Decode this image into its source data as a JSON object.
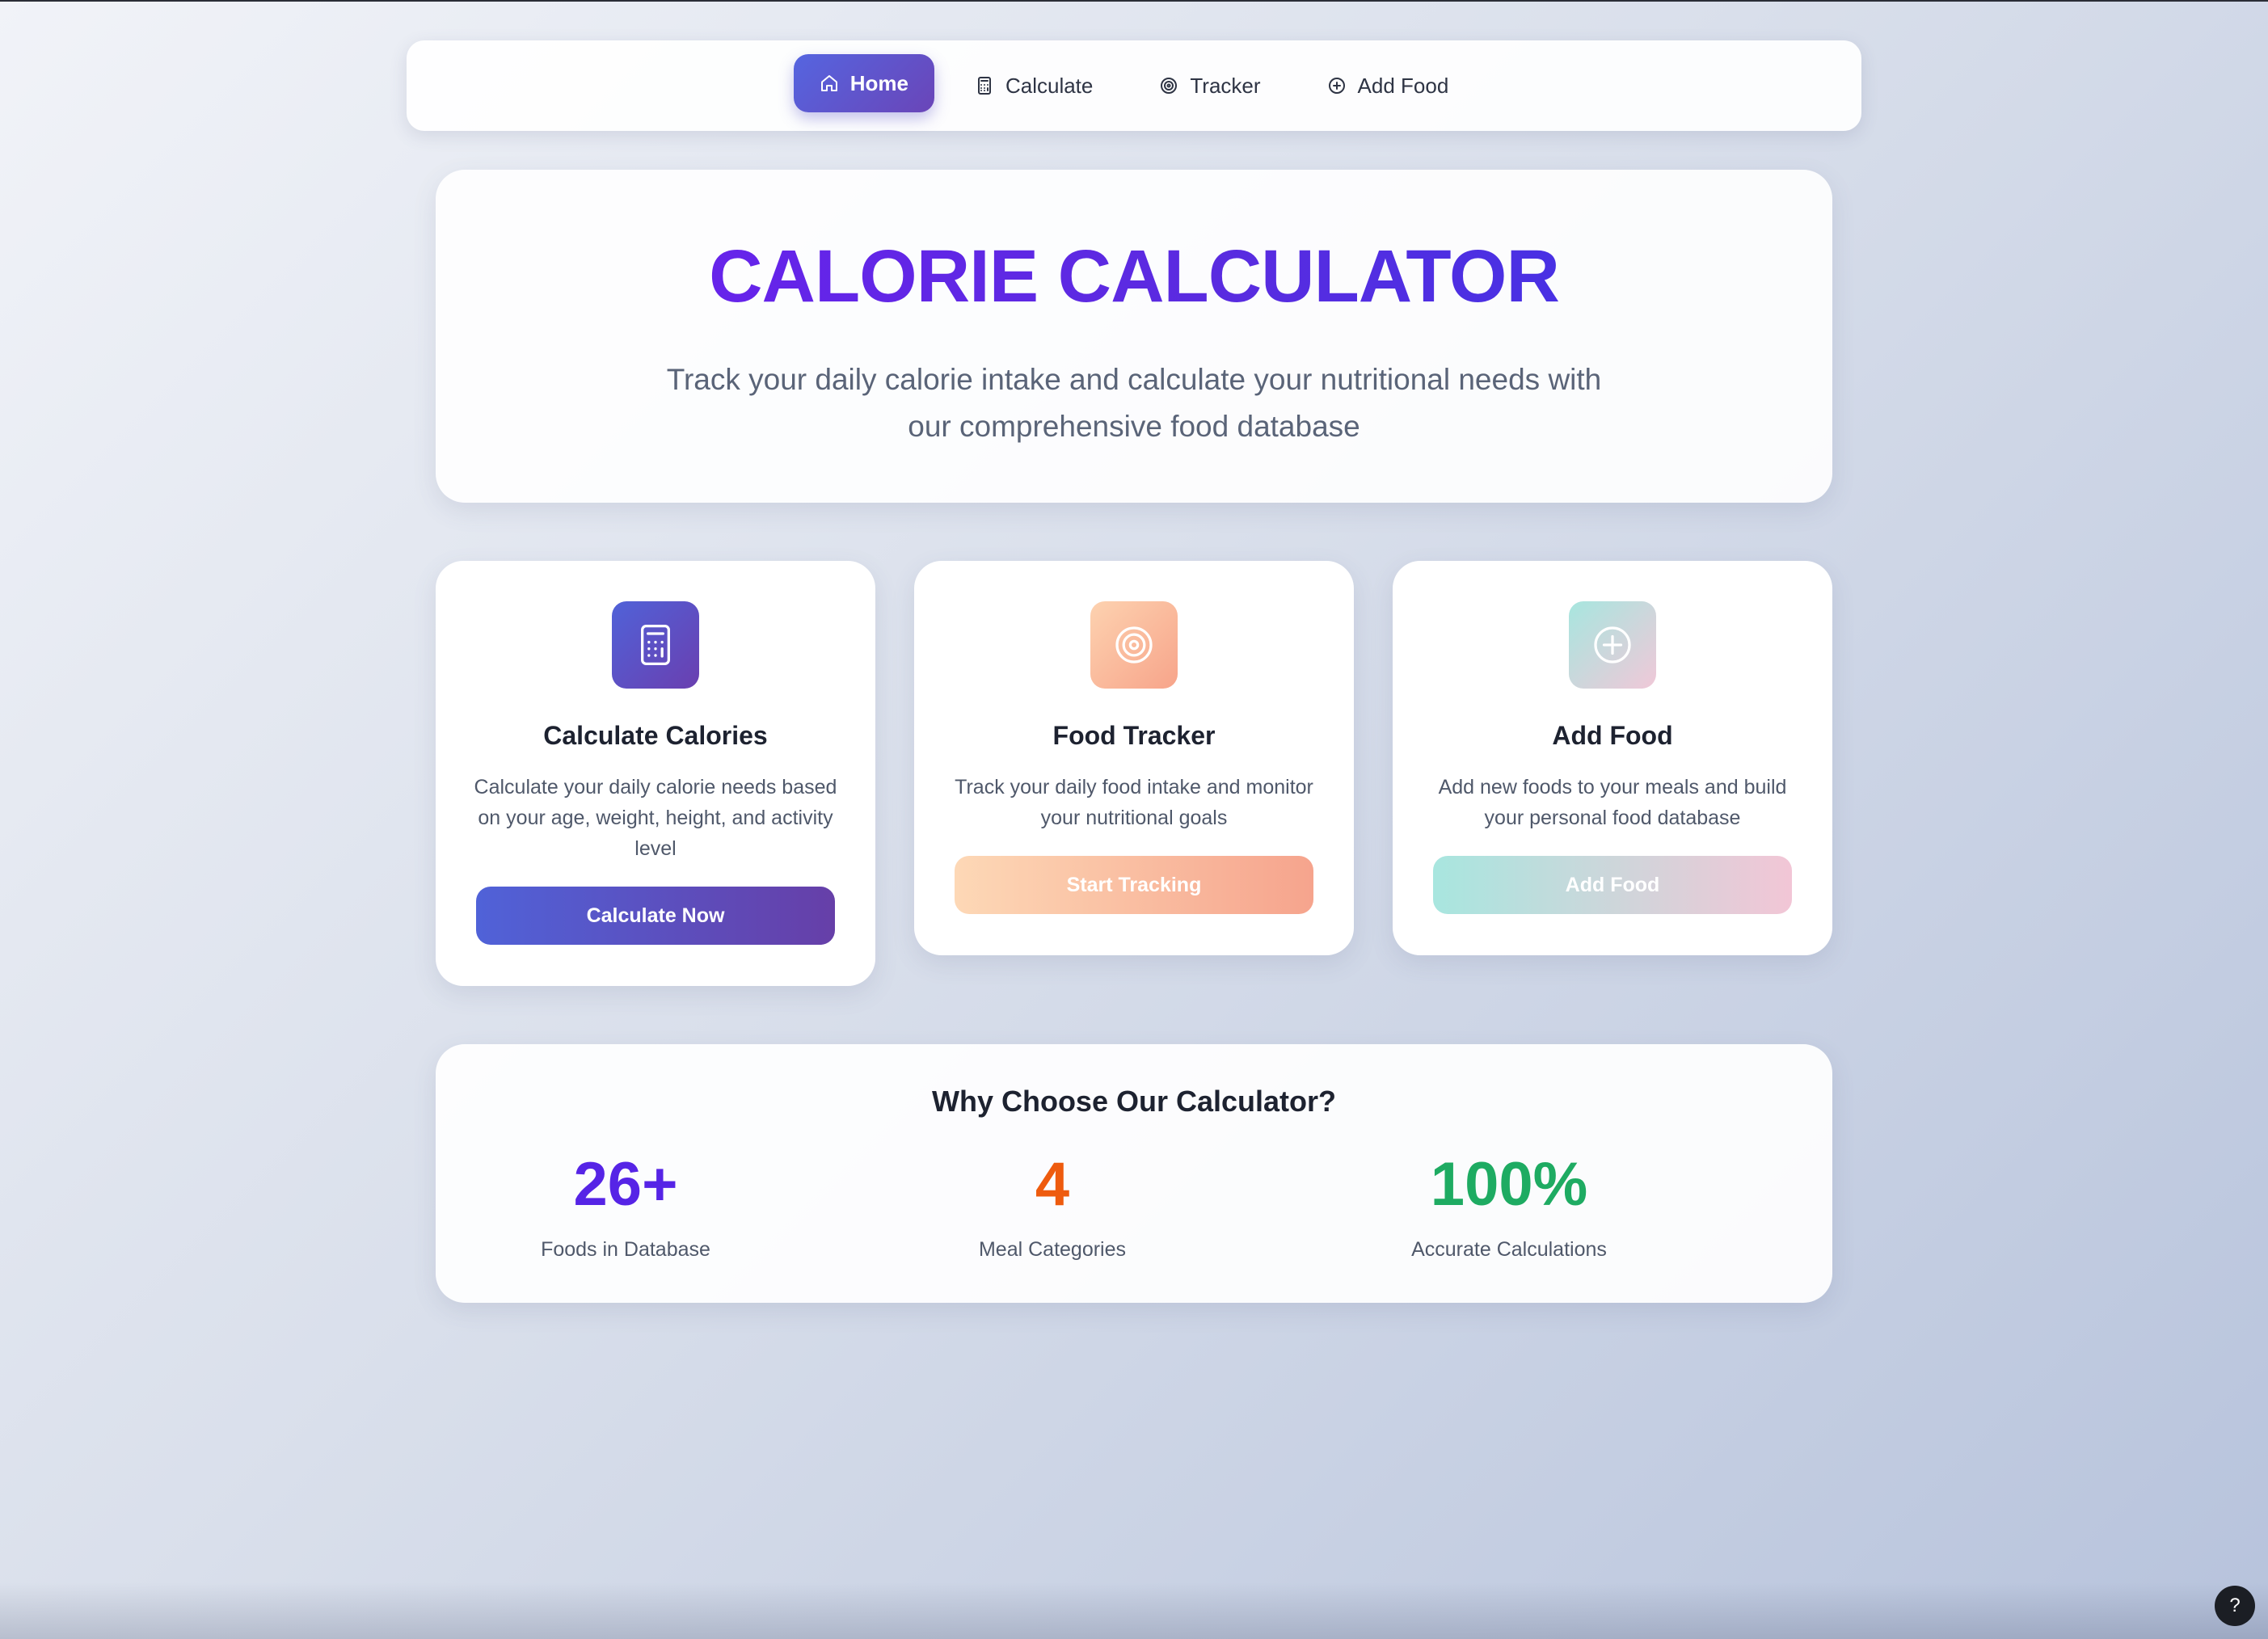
{
  "nav": {
    "items": [
      {
        "label": "Home",
        "icon": "home-icon",
        "active": true
      },
      {
        "label": "Calculate",
        "icon": "calculator-icon",
        "active": false
      },
      {
        "label": "Tracker",
        "icon": "target-icon",
        "active": false
      },
      {
        "label": "Add Food",
        "icon": "plus-circle-icon",
        "active": false
      }
    ]
  },
  "hero": {
    "title": "CALORIE CALCULATOR",
    "subtitle": "Track your daily calorie intake and calculate your nutritional needs with our comprehensive food database"
  },
  "cards": [
    {
      "icon": "calculator-icon",
      "title": "Calculate Calories",
      "description": "Calculate your daily calorie needs based on your age, weight, height, and activity level",
      "button": "Calculate Now"
    },
    {
      "icon": "target-icon",
      "title": "Food Tracker",
      "description": "Track your daily food intake and monitor your nutritional goals",
      "button": "Start Tracking"
    },
    {
      "icon": "plus-circle-icon",
      "title": "Add Food",
      "description": "Add new foods to your meals and build your personal food database",
      "button": "Add Food"
    }
  ],
  "why": {
    "title": "Why Choose Our Calculator?",
    "stats": [
      {
        "value": "26+",
        "label": "Foods in Database",
        "color": "#5624e6"
      },
      {
        "value": "4",
        "label": "Meal Categories",
        "color": "#ee5b0e"
      },
      {
        "value": "100%",
        "label": "Accurate Calculations",
        "color": "#1eab62"
      }
    ]
  },
  "help": {
    "label": "?"
  },
  "colors": {
    "primary": "#5565e0",
    "accent_purple": "#6a45b8",
    "peach": "#f7a48a",
    "mint": "#a8e6df"
  }
}
